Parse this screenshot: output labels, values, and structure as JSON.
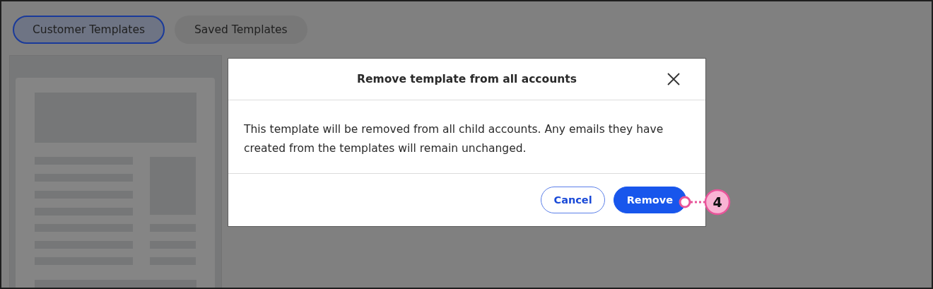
{
  "tabs": [
    {
      "label": "Customer Templates",
      "selected": true
    },
    {
      "label": "Saved Templates",
      "selected": false
    }
  ],
  "dialog": {
    "title": "Remove template from all accounts",
    "message": "This template will be removed from all child accounts. Any emails they have created from the templates will remain unchanged.",
    "buttons": [
      {
        "label": "Cancel",
        "kind": "secondary"
      },
      {
        "label": "Remove",
        "kind": "primary"
      }
    ]
  },
  "callout": {
    "number": "4"
  }
}
